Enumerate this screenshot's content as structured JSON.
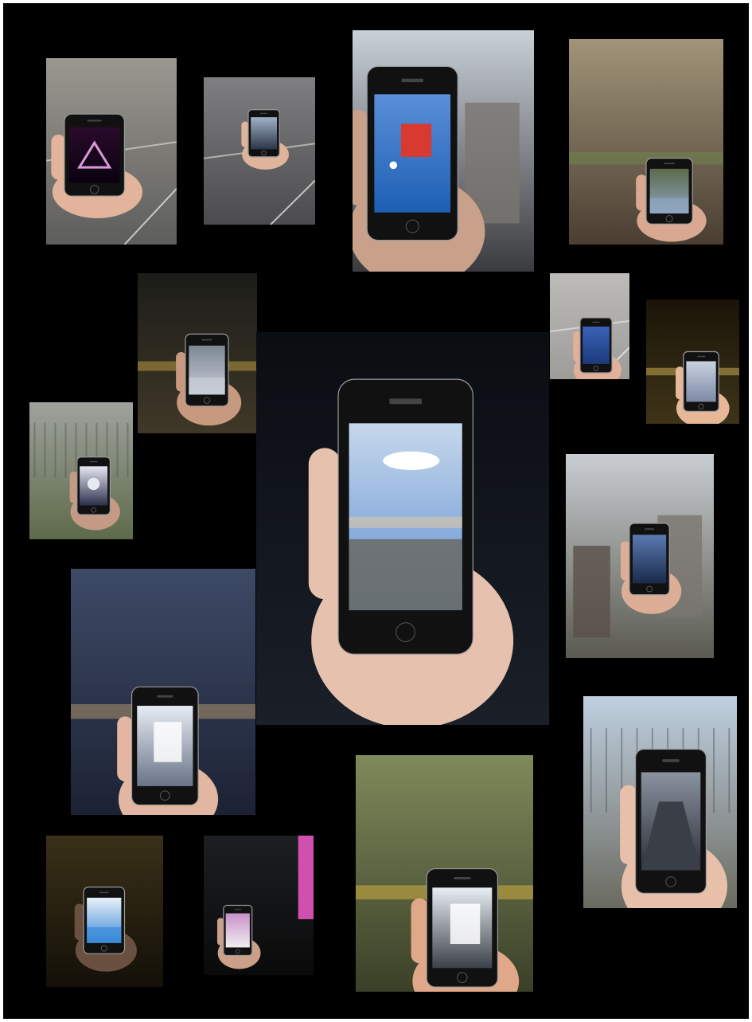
{
  "collage": {
    "background": "#000000",
    "border": "#ffffff",
    "photos": [
      {
        "id": "p1",
        "scene": "street",
        "screen": "neon-triangle",
        "colors": {
          "bg1": "#9a9890",
          "bg2": "#5d5d5b",
          "screen1": "#0a0210",
          "screen2": "#2a0a2a",
          "accent": "#d79ad6",
          "skin": "#e3b49c"
        }
      },
      {
        "id": "p2",
        "scene": "station-hall",
        "screen": "building",
        "colors": {
          "bg1": "#7f7f82",
          "bg2": "#4b4b4e",
          "screen1": "#2c3546",
          "screen2": "#9fb1c8",
          "accent": "#b04040",
          "skin": "#e0b49a"
        }
      },
      {
        "id": "p3",
        "scene": "city-street",
        "screen": "flag",
        "colors": {
          "bg1": "#c9d0d8",
          "bg2": "#3a3b3e",
          "screen1": "#1d5fb4",
          "screen2": "#5a8fd8",
          "accent": "#d83a30",
          "skin": "#c9a089"
        }
      },
      {
        "id": "p4",
        "scene": "train-window",
        "screen": "landscape",
        "colors": {
          "bg1": "#a19479",
          "bg2": "#4a3e32",
          "screen1": "#8ea6c2",
          "screen2": "#5c6a4a",
          "accent": "#6f8c4a",
          "skin": "#d9a890"
        }
      },
      {
        "id": "p5",
        "scene": "train-interior",
        "screen": "snow",
        "colors": {
          "bg1": "#1c1c18",
          "bg2": "#3f3828",
          "screen1": "#c9cfd8",
          "screen2": "#7d8694",
          "accent": "#d8b04a",
          "skin": "#c79a80"
        }
      },
      {
        "id": "p6",
        "scene": "floor",
        "screen": "blue-pattern",
        "colors": {
          "bg1": "#bdbbb8",
          "bg2": "#9e9c99",
          "screen1": "#1b3a7a",
          "screen2": "#3a62b8",
          "accent": "#ffffff",
          "skin": "#e0b09a"
        }
      },
      {
        "id": "p7",
        "scene": "tunnel",
        "screen": "alley",
        "colors": {
          "bg1": "#1a1408",
          "bg2": "#3e3418",
          "screen1": "#7d8aa6",
          "screen2": "#c9d2e0",
          "accent": "#e8c860",
          "skin": "#e6b898"
        }
      },
      {
        "id": "p8",
        "scene": "fog-field",
        "screen": "sun-silhouette",
        "colors": {
          "bg1": "#9ea39d",
          "bg2": "#5e6a4a",
          "screen1": "#2c2f4a",
          "screen2": "#e6e8f4",
          "accent": "#ffffff",
          "skin": "#c49a85"
        }
      },
      {
        "id": "p9",
        "scene": "dark",
        "screen": "sky-clouds",
        "colors": {
          "bg1": "#0a0d12",
          "bg2": "#1a1f28",
          "screen1": "#5f8fd0",
          "screen2": "#c6d8ec",
          "accent": "#d8c8a8",
          "skin": "#e6c2ae"
        }
      },
      {
        "id": "p10",
        "scene": "city-view",
        "screen": "night-mountain",
        "colors": {
          "bg1": "#c9cdd2",
          "bg2": "#5a5a50",
          "screen1": "#1a2a4a",
          "screen2": "#5a7ab0",
          "accent": "#8a6a50",
          "skin": "#dcae96"
        }
      },
      {
        "id": "p11",
        "scene": "train-seat",
        "screen": "window-light",
        "colors": {
          "bg1": "#3d4a66",
          "bg2": "#1c2234",
          "screen1": "#6a7488",
          "screen2": "#e6ecf4",
          "accent": "#c8a870",
          "skin": "#e2b6a0"
        }
      },
      {
        "id": "p12",
        "scene": "moving-field",
        "screen": "gallery",
        "colors": {
          "bg1": "#7e8a5a",
          "bg2": "#3a4028",
          "screen1": "#3c4048",
          "screen2": "#e8eef4",
          "accent": "#e8c040",
          "skin": "#e0a888"
        }
      },
      {
        "id": "p13",
        "scene": "forest-road",
        "screen": "road",
        "colors": {
          "bg1": "#bfd0e0",
          "bg2": "#6a6a60",
          "screen1": "#2c3038",
          "screen2": "#8a92a0",
          "accent": "#4a7ab8",
          "skin": "#e8c0aa"
        }
      },
      {
        "id": "p14",
        "scene": "dim-room",
        "screen": "blue-sky",
        "colors": {
          "bg1": "#3a3018",
          "bg2": "#141008",
          "screen1": "#3a8ad8",
          "screen2": "#e8f0f8",
          "accent": "#e6d090",
          "skin": "#6a5040"
        }
      },
      {
        "id": "p15",
        "scene": "night-window",
        "screen": "night-lights",
        "colors": {
          "bg1": "#1c1e22",
          "bg2": "#0a0a0a",
          "screen1": "#f0eef0",
          "screen2": "#c890c8",
          "accent": "#d050b0",
          "skin": "#caa088"
        }
      }
    ]
  }
}
